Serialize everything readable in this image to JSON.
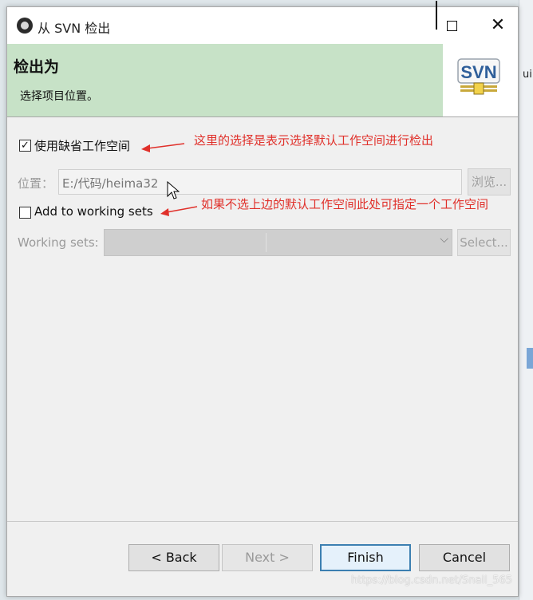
{
  "window": {
    "title": "从 SVN 检出",
    "controls": {
      "maximize_icon": "maximize-icon",
      "close_icon": "close-icon",
      "close_glyph": "✕"
    }
  },
  "background": {
    "right_fragment": "ui"
  },
  "banner": {
    "title": "检出为",
    "subtitle": "选择项目位置。",
    "logo_text": "SVN"
  },
  "form": {
    "use_default_workspace": {
      "label": "使用缺省工作空间",
      "checked": true,
      "mark": "✓"
    },
    "location": {
      "label": "位置：",
      "value": "E:/代码/heima32",
      "browse_label": "浏览..."
    },
    "add_to_working_sets": {
      "label": "Add to working sets",
      "checked": false,
      "mark": ""
    },
    "working_sets": {
      "label": "Working sets:",
      "value": "",
      "select_label": "Select...",
      "chevron": "⌵"
    }
  },
  "annotations": {
    "default_workspace_note": "这里的选择是表示选择默认工作空间进行检出",
    "working_sets_note": "如果不选上边的默认工作空间此处可指定一个工作空间"
  },
  "buttons": {
    "back": "< Back",
    "next": "Next >",
    "finish": "Finish",
    "cancel": "Cancel"
  },
  "watermark": "https://blog.csdn.net/Snail_565",
  "colors": {
    "banner_bg": "#c7e2c7",
    "annotation": "#e0302a",
    "primary_border": "#3c7fb1"
  }
}
